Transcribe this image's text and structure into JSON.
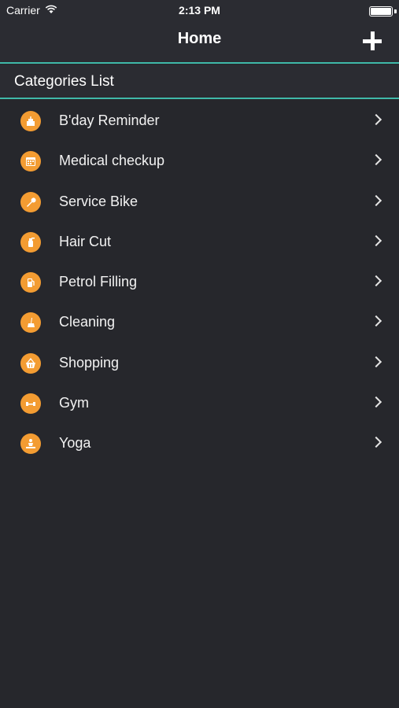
{
  "status_bar": {
    "carrier": "Carrier",
    "time": "2:13 PM",
    "icons": [
      "wifi-icon",
      "battery-icon"
    ]
  },
  "nav": {
    "title": "Home",
    "add_icon": "plus-icon"
  },
  "section": {
    "title": "Categories List"
  },
  "colors": {
    "accent": "#3fb9a9",
    "icon_background": "#f39c32",
    "background": "#26272c",
    "bar_background": "#2b2c32"
  },
  "categories": [
    {
      "label": "B'day Reminder",
      "icon": "cake-icon"
    },
    {
      "label": "Medical checkup",
      "icon": "calendar-icon"
    },
    {
      "label": "Service Bike",
      "icon": "wrench-icon"
    },
    {
      "label": "Hair Cut",
      "icon": "spray-bottle-icon"
    },
    {
      "label": "Petrol Filling",
      "icon": "fuel-pump-icon"
    },
    {
      "label": "Cleaning",
      "icon": "broom-icon"
    },
    {
      "label": "Shopping",
      "icon": "basket-icon"
    },
    {
      "label": "Gym",
      "icon": "dumbbell-icon"
    },
    {
      "label": "Yoga",
      "icon": "yoga-icon"
    }
  ]
}
